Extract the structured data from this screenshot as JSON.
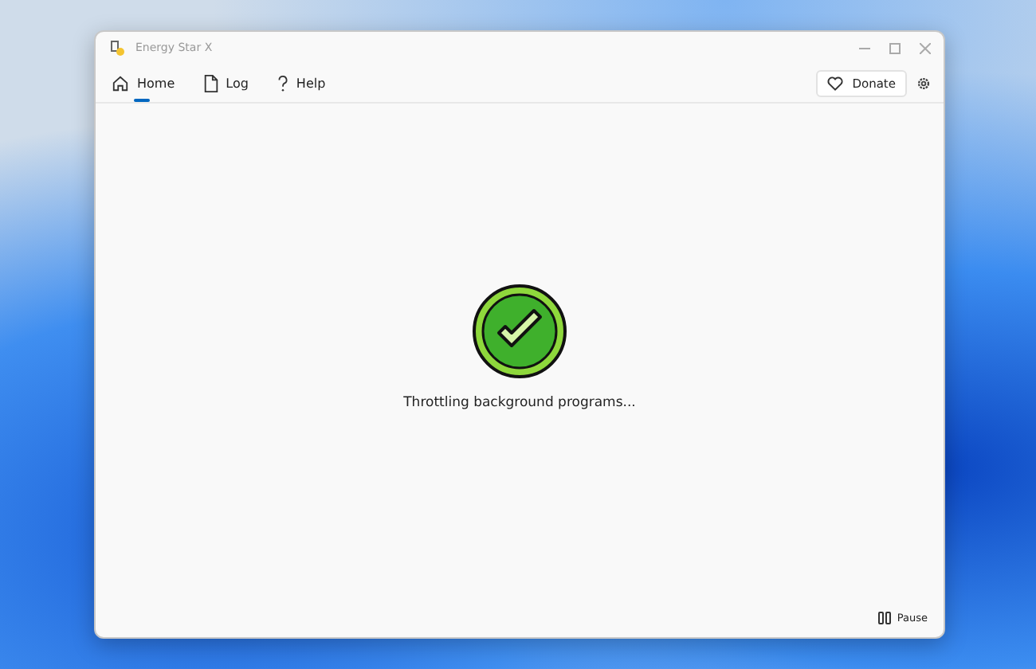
{
  "window": {
    "title": "Energy Star X"
  },
  "nav_tabs": [
    {
      "label": "Home",
      "kind": "home",
      "selected": true
    },
    {
      "label": "Log",
      "kind": "document",
      "selected": false
    },
    {
      "label": "Help",
      "kind": "question",
      "selected": false
    }
  ],
  "donate_button": {
    "label": "Donate"
  },
  "status": {
    "text": "Throttling background programs..."
  },
  "pause_button": {
    "label": "Pause"
  }
}
